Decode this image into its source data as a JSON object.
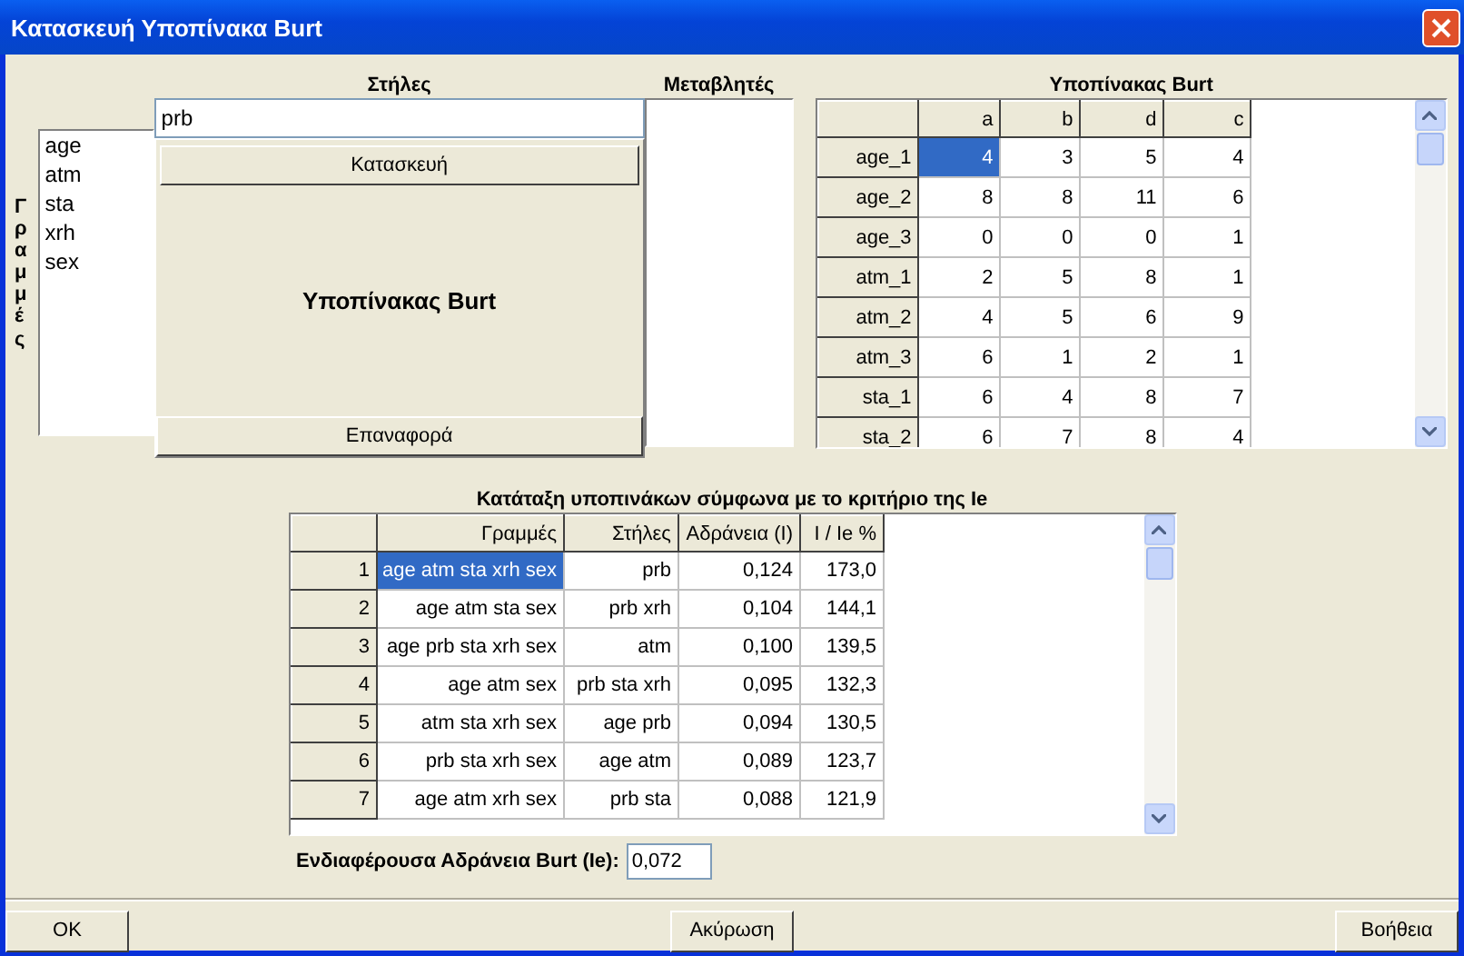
{
  "window": {
    "title": "Κατασκευή Υποπίνακα Burt"
  },
  "rows_panel": {
    "label": "Γραμμές",
    "items": [
      "age",
      "atm",
      "sta",
      "xrh",
      "sex"
    ]
  },
  "columns_panel": {
    "label": "Στήλες",
    "value": "prb",
    "build_button": "Κατασκευή",
    "caption": "Υποπίνακας Burt",
    "reset_button": "Επαναφορά"
  },
  "variables_panel": {
    "label": "Μεταβλητές"
  },
  "burt_table": {
    "title": "Υποπίνακας Burt",
    "columns": [
      "a",
      "b",
      "d",
      "c"
    ],
    "rows": [
      {
        "label": "age_1",
        "cells": [
          "4",
          "3",
          "5",
          "4"
        ],
        "selected": true
      },
      {
        "label": "age_2",
        "cells": [
          "8",
          "8",
          "11",
          "6"
        ],
        "selected": false
      },
      {
        "label": "age_3",
        "cells": [
          "0",
          "0",
          "0",
          "1"
        ],
        "selected": false
      },
      {
        "label": "atm_1",
        "cells": [
          "2",
          "5",
          "8",
          "1"
        ],
        "selected": false
      },
      {
        "label": "atm_2",
        "cells": [
          "4",
          "5",
          "6",
          "9"
        ],
        "selected": false
      },
      {
        "label": "atm_3",
        "cells": [
          "6",
          "1",
          "2",
          "1"
        ],
        "selected": false
      },
      {
        "label": "sta_1",
        "cells": [
          "6",
          "4",
          "8",
          "7"
        ],
        "selected": false
      },
      {
        "label": "sta_2",
        "cells": [
          "6",
          "7",
          "8",
          "4"
        ],
        "selected": false
      }
    ]
  },
  "ranking": {
    "title": "Κατάταξη υποπινάκων σύμφωνα με το κριτήριο της Ie",
    "columns": [
      "Γραμμές",
      "Στήλες",
      "Αδράνεια (I)",
      "I / Ie %"
    ],
    "rows": [
      {
        "index": "1",
        "cells": [
          "age atm sta xrh sex",
          "prb",
          "0,124",
          "173,0"
        ],
        "selected": true
      },
      {
        "index": "2",
        "cells": [
          "age atm sta sex",
          "prb xrh",
          "0,104",
          "144,1"
        ],
        "selected": false
      },
      {
        "index": "3",
        "cells": [
          "age prb sta xrh sex",
          "atm",
          "0,100",
          "139,5"
        ],
        "selected": false
      },
      {
        "index": "4",
        "cells": [
          "age atm sex",
          "prb sta xrh",
          "0,095",
          "132,3"
        ],
        "selected": false
      },
      {
        "index": "5",
        "cells": [
          "atm sta xrh sex",
          "age prb",
          "0,094",
          "130,5"
        ],
        "selected": false
      },
      {
        "index": "6",
        "cells": [
          "prb sta xrh sex",
          "age atm",
          "0,089",
          "123,7"
        ],
        "selected": false
      },
      {
        "index": "7",
        "cells": [
          "age atm xrh sex",
          "prb sta",
          "0,088",
          "121,9"
        ],
        "selected": false
      }
    ]
  },
  "interesting_inertia": {
    "label": "Ενδιαφέρουσα Αδράνεια Burt (Ie):",
    "value": "0,072"
  },
  "buttons": [
    "OK",
    "Ακύρωση",
    "Βοήθεια"
  ]
}
